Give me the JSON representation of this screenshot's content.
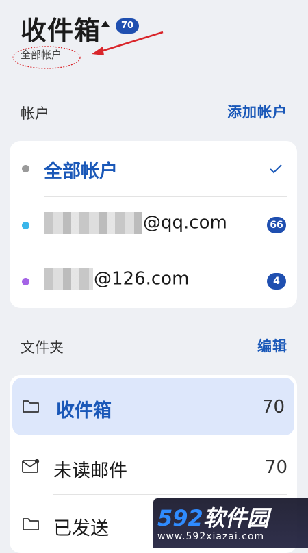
{
  "header": {
    "title": "收件箱",
    "badge": "70",
    "subtitle": "全部帐户"
  },
  "accounts_section": {
    "label": "帐户",
    "action": "添加帐户",
    "items": [
      {
        "label": "全部帐户",
        "dot_color": "#9a9a9a",
        "selected": true
      },
      {
        "label": "@qq.com",
        "dot_color": "#3ab6ea",
        "count": "66"
      },
      {
        "label": "@126.com",
        "dot_color": "#a463e6",
        "count": "4"
      }
    ]
  },
  "folders_section": {
    "label": "文件夹",
    "action": "编辑",
    "items": [
      {
        "label": "收件箱",
        "count": "70",
        "icon": "folder-icon",
        "active": true
      },
      {
        "label": "未读邮件",
        "count": "70",
        "icon": "unread-mail-icon"
      },
      {
        "label": "已发送",
        "icon": "folder-icon"
      }
    ]
  },
  "watermark": {
    "num": "592",
    "text": "软件园",
    "url": "www.592xiazai.com"
  },
  "colors": {
    "accent": "#1a58b8",
    "badge": "#1f4fb0",
    "annotation": "#d9262b"
  }
}
